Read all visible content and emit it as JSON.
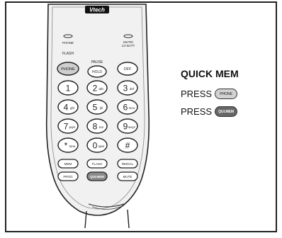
{
  "brand": "Vtech",
  "indicators": {
    "phone_label": "PHONE",
    "mute_label": "MUTE/",
    "lobatt_label": "LO BATT"
  },
  "top_keys": {
    "flash_label": "FLASH",
    "pause_label": "PAUSE",
    "phone": "PHONE",
    "hold": "HOLD",
    "off": "OFF"
  },
  "keypad": [
    {
      "digit": "1",
      "sub": ""
    },
    {
      "digit": "2",
      "sub": "abc"
    },
    {
      "digit": "3",
      "sub": "def"
    },
    {
      "digit": "4",
      "sub": "ghi"
    },
    {
      "digit": "5",
      "sub": "jkl"
    },
    {
      "digit": "6",
      "sub": "mno"
    },
    {
      "digit": "7",
      "sub": "pqrs"
    },
    {
      "digit": "8",
      "sub": "tuv"
    },
    {
      "digit": "9",
      "sub": "wxyz"
    },
    {
      "digit": "*",
      "sub": "tone"
    },
    {
      "digit": "0",
      "sub": "oper"
    },
    {
      "digit": "#",
      "sub": ""
    }
  ],
  "function_keys": [
    "MEM",
    "FLASH",
    "REDIAL",
    "PROG",
    "QUI.MEM",
    "MUTE"
  ],
  "instructions": {
    "title": "QUICK MEM",
    "step1_text": "PRESS",
    "step1_button": "PHONE",
    "step2_text": "PRESS",
    "step2_button": "QUI.MEM"
  },
  "colors": {
    "highlight_button": "#cfcfcf",
    "dark_button": "#6a6a6a",
    "handset_body": "#efefef",
    "outline": "#222222"
  }
}
